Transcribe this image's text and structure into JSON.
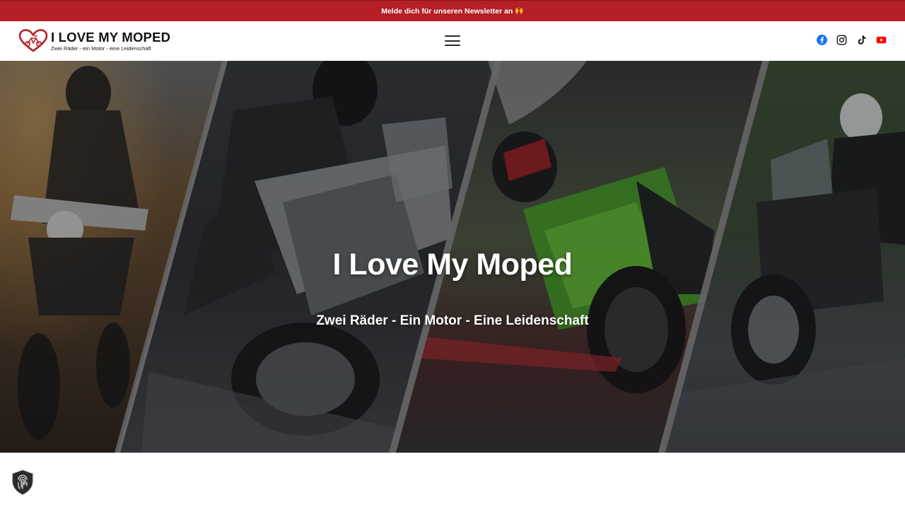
{
  "announcement": {
    "text": "Melde dich für unseren Newsletter an",
    "emoji": "🙌"
  },
  "header": {
    "logo_title": "I LOVE MY MOPED",
    "logo_tagline": "Zwei Räder - ein Motor - eine Leidenschaft",
    "menu_icon": "hamburger-menu-icon",
    "socials": [
      {
        "name": "facebook",
        "icon": "facebook-icon",
        "color": "#1877f2"
      },
      {
        "name": "instagram",
        "icon": "instagram-icon",
        "color": "#111111"
      },
      {
        "name": "tiktok",
        "icon": "tiktok-icon",
        "color": "#111111"
      },
      {
        "name": "youtube",
        "icon": "youtube-icon",
        "color": "#ff0000"
      }
    ]
  },
  "hero": {
    "title": "I Love My Moped",
    "subtitle": "Zwei Räder - Ein Motor - Eine Leidenschaft"
  },
  "privacy_badge": {
    "icon": "fingerprint-shield-icon"
  },
  "colors": {
    "brand_red": "#b51f26",
    "panel_gray": "#8e8e8e"
  }
}
